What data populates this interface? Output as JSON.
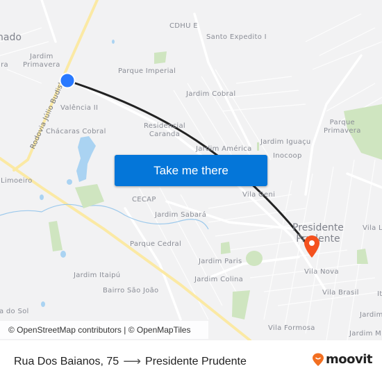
{
  "map": {
    "labels": {
      "city_partial_left": "nado",
      "jardim_primavera": "Jardim\nPrimavera",
      "left_partial_ira": "ira",
      "cdhu": "CDHU E",
      "santo_expedito": "Santo Expedito I",
      "parque_imperial": "Parque Imperial",
      "jardim_cobral": "Jardim Cobral",
      "valencia": "Valência II",
      "chacaras_cobral": "Chácaras Cobral",
      "residencial_caranda": "Residencial\nCaranda",
      "parque_primavera": "Parque\nPrimavera",
      "jardim_america": "Jardim América",
      "jardim_iguacu": "Jardim Iguaçu",
      "inocoop": "Inocoop",
      "limoeiro": "Limoeiro",
      "cecap": "CECAP",
      "vila_geni": "Vila Geni",
      "jardim_sabara": "Jardim Sabará",
      "presidente_prudente": "Presidente\nPrudente",
      "vila_l": "Vila L",
      "parque_cedral": "Parque Cedral",
      "jardim_paris": "Jardim Paris",
      "vila_nova": "Vila Nova",
      "jardim_itaipu": "Jardim Itaipú",
      "jardim_colina": "Jardim Colina",
      "vila_brasil": "Vila Brasil",
      "it_partial": "It",
      "bairro_sao_joao": "Bairro São João",
      "vila_do_sol": "a do Sol",
      "jardim_right_1": "Jardim",
      "vila_formosa": "Vila Formosa",
      "jardim_right_2": "Jardim M",
      "road_name": "Rodovia Júlio Budisk"
    },
    "origin_marker_icon": "origin-dot-icon",
    "destination_marker_icon": "destination-pin-icon",
    "route_color": "#222222",
    "origin_color": "#2979ff",
    "destination_color": "#f4511e"
  },
  "cta": {
    "label": "Take me there",
    "color": "#0476d9"
  },
  "attribution": {
    "text": "© OpenStreetMap contributors | © OpenMapTiles"
  },
  "footer": {
    "origin": "Rua Dos Baianos, 75",
    "arrow_icon": "arrow-right-icon",
    "destination": "Presidente Prudente",
    "brand": "moovit",
    "brand_color": "#f26f21"
  }
}
